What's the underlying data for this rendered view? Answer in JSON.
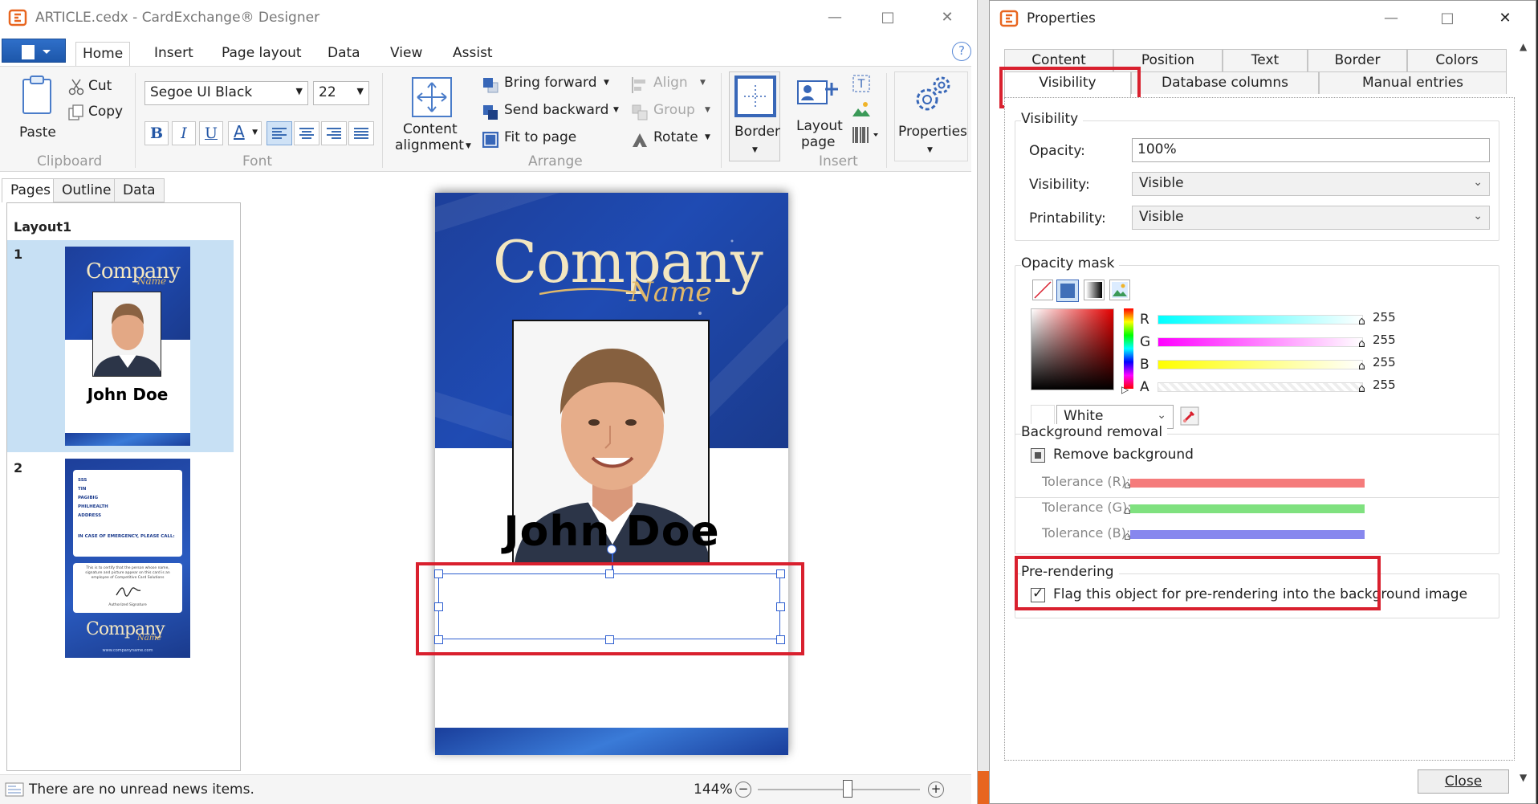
{
  "designer": {
    "title": "ARTICLE.cedx - CardExchange® Designer",
    "ribbon_tabs": [
      "Home",
      "Insert",
      "Page layout",
      "Data",
      "View",
      "Assist"
    ],
    "clipboard": {
      "paste": "Paste",
      "cut": "Cut",
      "copy": "Copy",
      "group": "Clipboard"
    },
    "font": {
      "family": "Segoe UI Black",
      "size": "22",
      "group": "Font",
      "bold": "B",
      "italic": "I",
      "underline": "U",
      "color": "A"
    },
    "arrange": {
      "content_alignment_1": "Content",
      "content_alignment_2": "alignment",
      "bring_forward": "Bring forward",
      "send_backward": "Send backward",
      "fit_to_page": "Fit to page",
      "align": "Align",
      "group_btn": "Group",
      "rotate": "Rotate",
      "group": "Arrange"
    },
    "insert": {
      "border": "Border",
      "layout_page_1": "Layout",
      "layout_page_2": "page",
      "group": "Insert"
    },
    "properties_btn": "Properties",
    "left_tabs": [
      "Pages",
      "Outline",
      "Data"
    ],
    "layout_name": "Layout1",
    "pages": [
      "1",
      "2"
    ],
    "thumb1": {
      "logo": "Company",
      "logo_sub": "Name",
      "name": "John Doe"
    },
    "thumb2": {
      "fields": [
        "SSS",
        "TIN",
        "PAGIBIG",
        "PHILHEALTH",
        "ADDRESS"
      ],
      "emergency": "IN CASE OF EMERGENCY, PLEASE CALL:",
      "certify": "This is to certify that the person whose name, signature and picture appear on this card is an employee of Competitive Card Solutions",
      "sig_label": "Authorized Signature",
      "logo": "Company",
      "logo_sub": "Name",
      "url": "www.companyname.com"
    },
    "card": {
      "logo": "Company",
      "logo_sub": "Name",
      "name": "John Doe"
    },
    "status": {
      "news": "There are no unread news items.",
      "zoom": "144%"
    }
  },
  "properties": {
    "title": "Properties",
    "tabs_row1": [
      "Content",
      "Position",
      "Text",
      "Border",
      "Colors"
    ],
    "tabs_row2": [
      "Visibility",
      "Database columns",
      "Manual entries"
    ],
    "visibility": {
      "section": "Visibility",
      "opacity_label": "Opacity:",
      "opacity_value": "100%",
      "visibility_label": "Visibility:",
      "visibility_value": "Visible",
      "printability_label": "Printability:",
      "printability_value": "Visible"
    },
    "opacity_mask": {
      "section": "Opacity mask",
      "channels": [
        {
          "name": "R",
          "value": "255"
        },
        {
          "name": "G",
          "value": "255"
        },
        {
          "name": "B",
          "value": "255"
        },
        {
          "name": "A",
          "value": "255"
        }
      ],
      "color_name": "White"
    },
    "background_removal": {
      "section": "Background removal",
      "remove_label": "Remove background",
      "tol_r": "Tolerance (R):",
      "tol_g": "Tolerance (G):",
      "tol_b": "Tolerance (B):"
    },
    "prerendering": {
      "section": "Pre-rendering",
      "flag_label": "Flag this object for pre-rendering into the background image",
      "checked": true
    },
    "close": "Close"
  },
  "colors": {
    "highlight": "#d9202e",
    "selection": "#2f5fd0",
    "card_blue": "#1f4bb3",
    "thumb_selected": "#c7e0f4"
  }
}
